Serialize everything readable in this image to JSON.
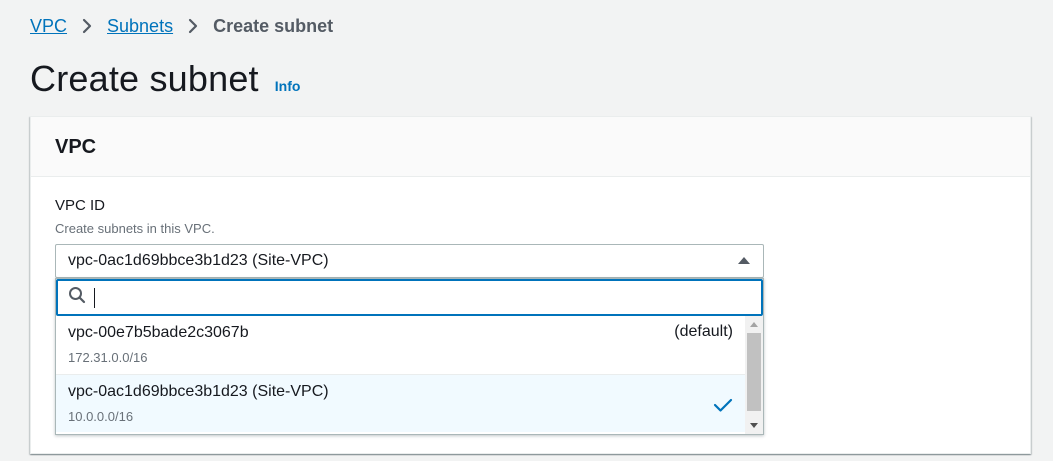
{
  "breadcrumb": {
    "items": [
      "VPC",
      "Subnets"
    ],
    "current": "Create subnet"
  },
  "page": {
    "title": "Create subnet",
    "info_label": "Info"
  },
  "container": {
    "title": "VPC"
  },
  "vpc_field": {
    "label": "VPC ID",
    "description": "Create subnets in this VPC.",
    "selected_value": "vpc-0ac1d69bbce3b1d23 (Site-VPC)",
    "filter_value": "",
    "options": [
      {
        "label": "vpc-00e7b5bade2c3067b",
        "tag": "(default)",
        "description": "172.31.0.0/16",
        "selected": false
      },
      {
        "label": "vpc-0ac1d69bbce3b1d23 (Site-VPC)",
        "tag": "",
        "description": "10.0.0.0/16",
        "selected": true
      }
    ]
  },
  "colors": {
    "link": "#0073bb",
    "selected_bg": "#f1faff",
    "focus_border": "#0073bb"
  },
  "icons": {
    "breadcrumb_separator": "chevron-right-icon",
    "select_caret": "caret-up-icon",
    "filter": "search-icon",
    "selected_option": "check-icon"
  }
}
